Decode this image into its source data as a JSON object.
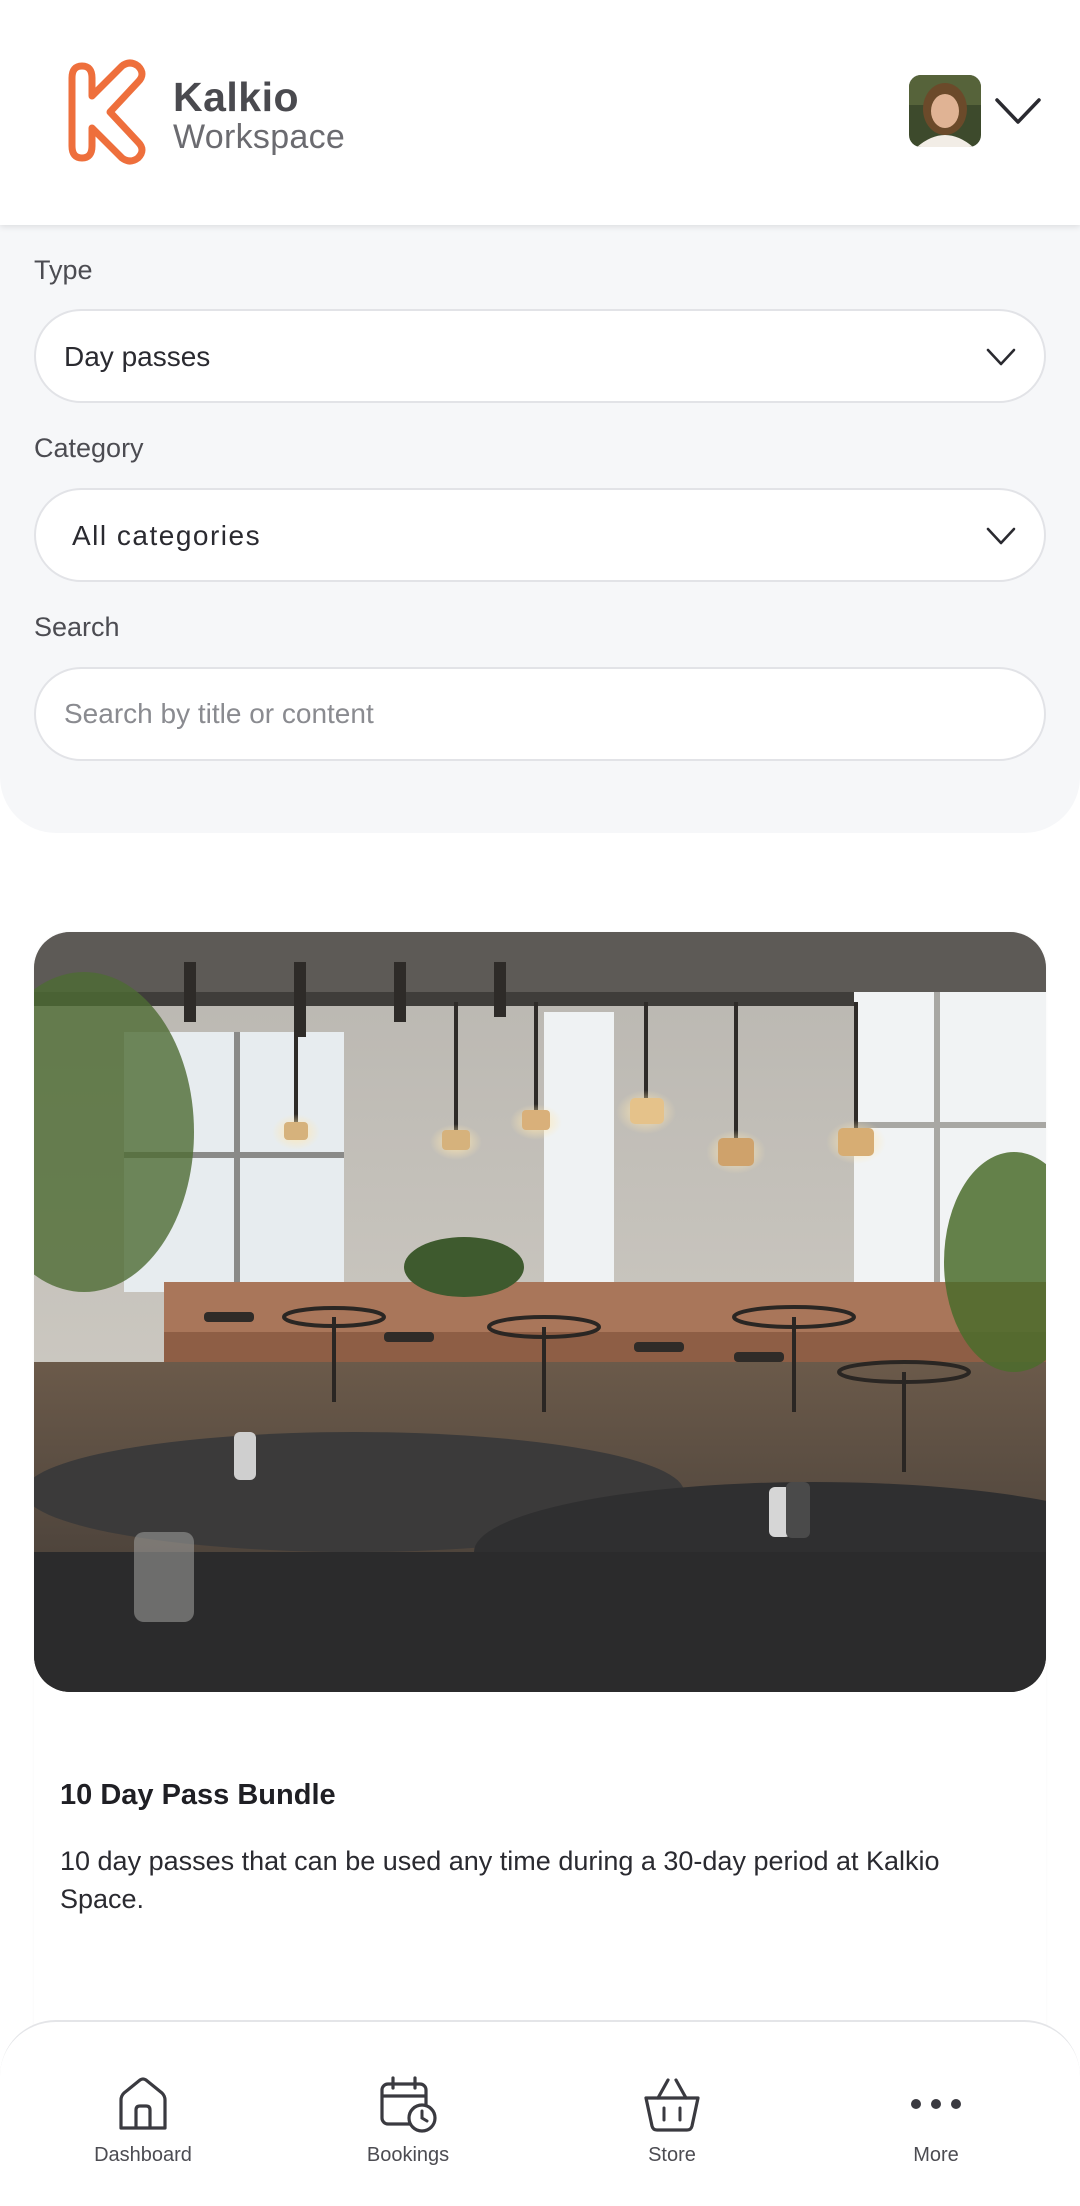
{
  "header": {
    "brand_name": "Kalkio",
    "brand_sub": "Workspace",
    "accent_color": "#ee6f3c"
  },
  "filters": {
    "type_label": "Type",
    "type_value": "Day passes",
    "category_label": "Category",
    "category_value": "All categories",
    "search_label": "Search",
    "search_placeholder": "Search by title or content"
  },
  "product": {
    "title": "10 Day Pass Bundle",
    "description": "10 day passes that can be used any time during a 30-day period at Kalkio Space."
  },
  "nav": {
    "items": [
      {
        "label": "Dashboard",
        "icon": "home-icon"
      },
      {
        "label": "Bookings",
        "icon": "calendar-clock-icon"
      },
      {
        "label": "Store",
        "icon": "basket-icon"
      },
      {
        "label": "More",
        "icon": "more-dots-icon"
      }
    ]
  }
}
